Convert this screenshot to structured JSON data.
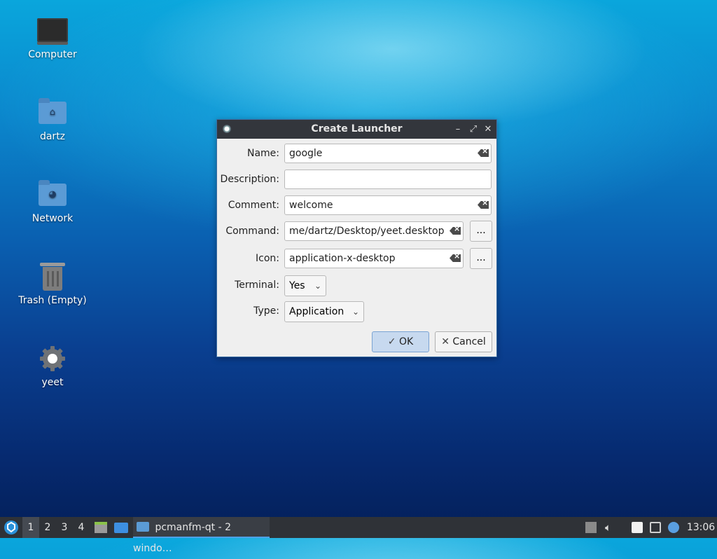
{
  "desktop": {
    "icons": [
      {
        "label": "Computer",
        "icon": "computer-icon"
      },
      {
        "label": "dartz",
        "icon": "home-folder-icon"
      },
      {
        "label": "Network",
        "icon": "network-folder-icon"
      },
      {
        "label": "Trash (Empty)",
        "icon": "trash-icon"
      },
      {
        "label": "yeet",
        "icon": "gear-icon"
      }
    ]
  },
  "dialog": {
    "title": "Create Launcher",
    "fields": {
      "name": {
        "label": "Name:",
        "value": "google"
      },
      "description": {
        "label": "Description:",
        "value": ""
      },
      "comment": {
        "label": "Comment:",
        "value": "welcome"
      },
      "command": {
        "label": "Command:",
        "value": "me/dartz/Desktop/yeet.desktop",
        "browse": "..."
      },
      "icon": {
        "label": "Icon:",
        "value": "application-x-desktop",
        "browse": "..."
      },
      "terminal": {
        "label": "Terminal:",
        "value": "Yes"
      },
      "type": {
        "label": "Type:",
        "value": "Application"
      }
    },
    "ok_label": "OK",
    "cancel_label": "Cancel"
  },
  "taskbar": {
    "workspaces": [
      "1",
      "2",
      "3",
      "4"
    ],
    "active_workspace": "1",
    "task_label": "pcmanfm-qt - 2 windo…",
    "clock": "13:06"
  },
  "colors": {
    "accent": "#4ea1e6",
    "titlebar": "#33363c",
    "panel": "#2f3237"
  }
}
